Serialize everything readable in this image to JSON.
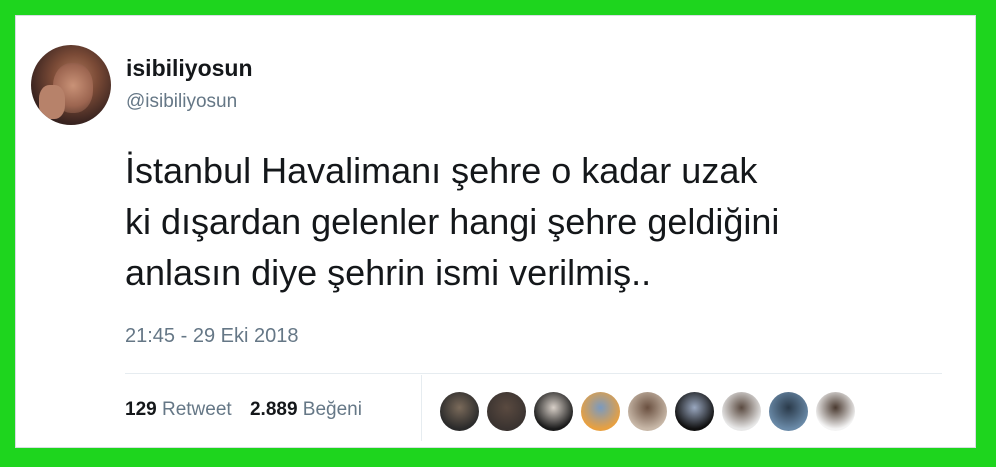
{
  "tweet": {
    "display_name": "isibiliyosun",
    "handle": "@isibiliyosun",
    "text": "İstanbul Havalimanı şehre o kadar uzak\nki dışardan gelenler hangi şehre geldiğini\nanlasın diye şehrin ismi verilmiş..",
    "timestamp": "21:45 - 29 Eki 2018"
  },
  "stats": {
    "retweets_count": "129",
    "retweets_label": "Retweet",
    "likes_count": "2.889",
    "likes_label": "Beğeni"
  },
  "colors": {
    "frame": "#1ed51e",
    "card": "#ffffff",
    "text_primary": "#14171a",
    "text_secondary": "#657786"
  },
  "likers": [
    {
      "name": "liker-avatar-1",
      "color": "#2a2a2a",
      "accent": "#7a6a5a"
    },
    {
      "name": "liker-avatar-2",
      "color": "#3a3330",
      "accent": "#5a4a40"
    },
    {
      "name": "liker-avatar-3",
      "color": "#1a1a1a",
      "accent": "#d8d0c8"
    },
    {
      "name": "liker-avatar-4",
      "color": "#e8a040",
      "accent": "#7a9ac0"
    },
    {
      "name": "liker-avatar-5",
      "color": "#c8b8a8",
      "accent": "#6a5040"
    },
    {
      "name": "liker-avatar-6",
      "color": "#101010",
      "accent": "#9aa8c0"
    },
    {
      "name": "liker-avatar-7",
      "color": "#e8e8e8",
      "accent": "#5a4a40"
    },
    {
      "name": "liker-avatar-8",
      "color": "#6a8aa8",
      "accent": "#2a3a4a"
    },
    {
      "name": "liker-avatar-9",
      "color": "#f4f4f4",
      "accent": "#4a3a30"
    }
  ]
}
